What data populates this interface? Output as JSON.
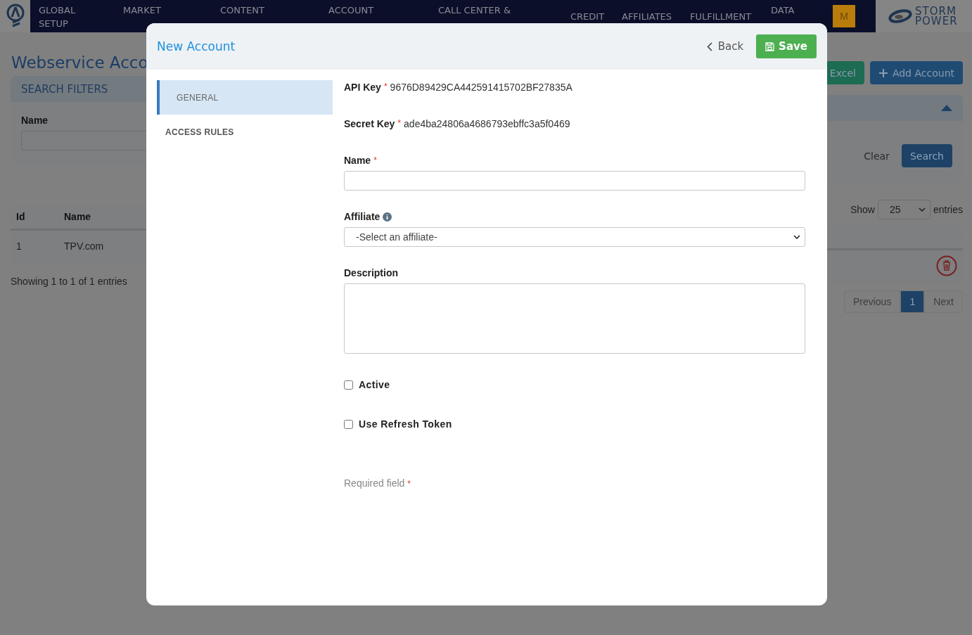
{
  "nav": {
    "items": [
      {
        "label": "GLOBAL",
        "sub": "SETUP"
      },
      {
        "label": "MARKET"
      },
      {
        "label": "CONTENT"
      },
      {
        "label": "ACCOUNT"
      },
      {
        "label": "CALL CENTER &"
      },
      {
        "label": "CREDIT"
      },
      {
        "label": "AFFILIATES"
      },
      {
        "label": "FULFILLMENT"
      },
      {
        "label": "DATA"
      }
    ],
    "avatar": "M",
    "brand": [
      "STORM",
      "POWER"
    ]
  },
  "page": {
    "title": "Webservice Acco",
    "buttons": [
      {
        "kind": "excel",
        "label": "Excel"
      },
      {
        "kind": "add",
        "label": "Add Account"
      }
    ],
    "filters": {
      "title": "SEARCH FILTERS",
      "expanded": true,
      "name_label": "Name",
      "clear": "Clear",
      "search": "Search"
    },
    "length": {
      "label": "Show",
      "value": "25",
      "suffix": "entries"
    },
    "table": {
      "columns": [
        "Id",
        "Name"
      ],
      "rows": [
        {
          "id": "1",
          "name": "TPV.com"
        }
      ]
    },
    "info": "Showing 1 to 1 of 1 entries",
    "pagination": [
      {
        "label": "Previous",
        "selected": false
      },
      {
        "label": "1",
        "selected": true
      },
      {
        "label": "Next",
        "selected": false
      }
    ]
  },
  "modal": {
    "title": "New Account",
    "back": "Back",
    "save": "Save",
    "tabs": [
      {
        "label": "GENERAL",
        "selected": true
      },
      {
        "label": "ACCESS RULES",
        "selected": false
      }
    ],
    "fields": [
      {
        "kind": "readonly",
        "label": "API Key",
        "mark": "*",
        "value": "9676D89429CA442591415702BF27835A"
      },
      {
        "kind": "readonly",
        "label": "Secret Key",
        "mark": "*",
        "value": "ade4ba24806a4686793ebffc3a5f0469"
      },
      {
        "kind": "text",
        "label": "Name",
        "mark": "*"
      },
      {
        "kind": "select",
        "label": "Affiliate",
        "info": true,
        "value": "-Select an affiliate-"
      },
      {
        "kind": "textarea",
        "label": "Description"
      },
      {
        "kind": "checkbox",
        "label": "Active",
        "checked": false
      },
      {
        "kind": "checkbox",
        "label": "Use Refresh Token",
        "checked": false
      }
    ],
    "note": {
      "text": "Required field",
      "mark": "*"
    }
  }
}
